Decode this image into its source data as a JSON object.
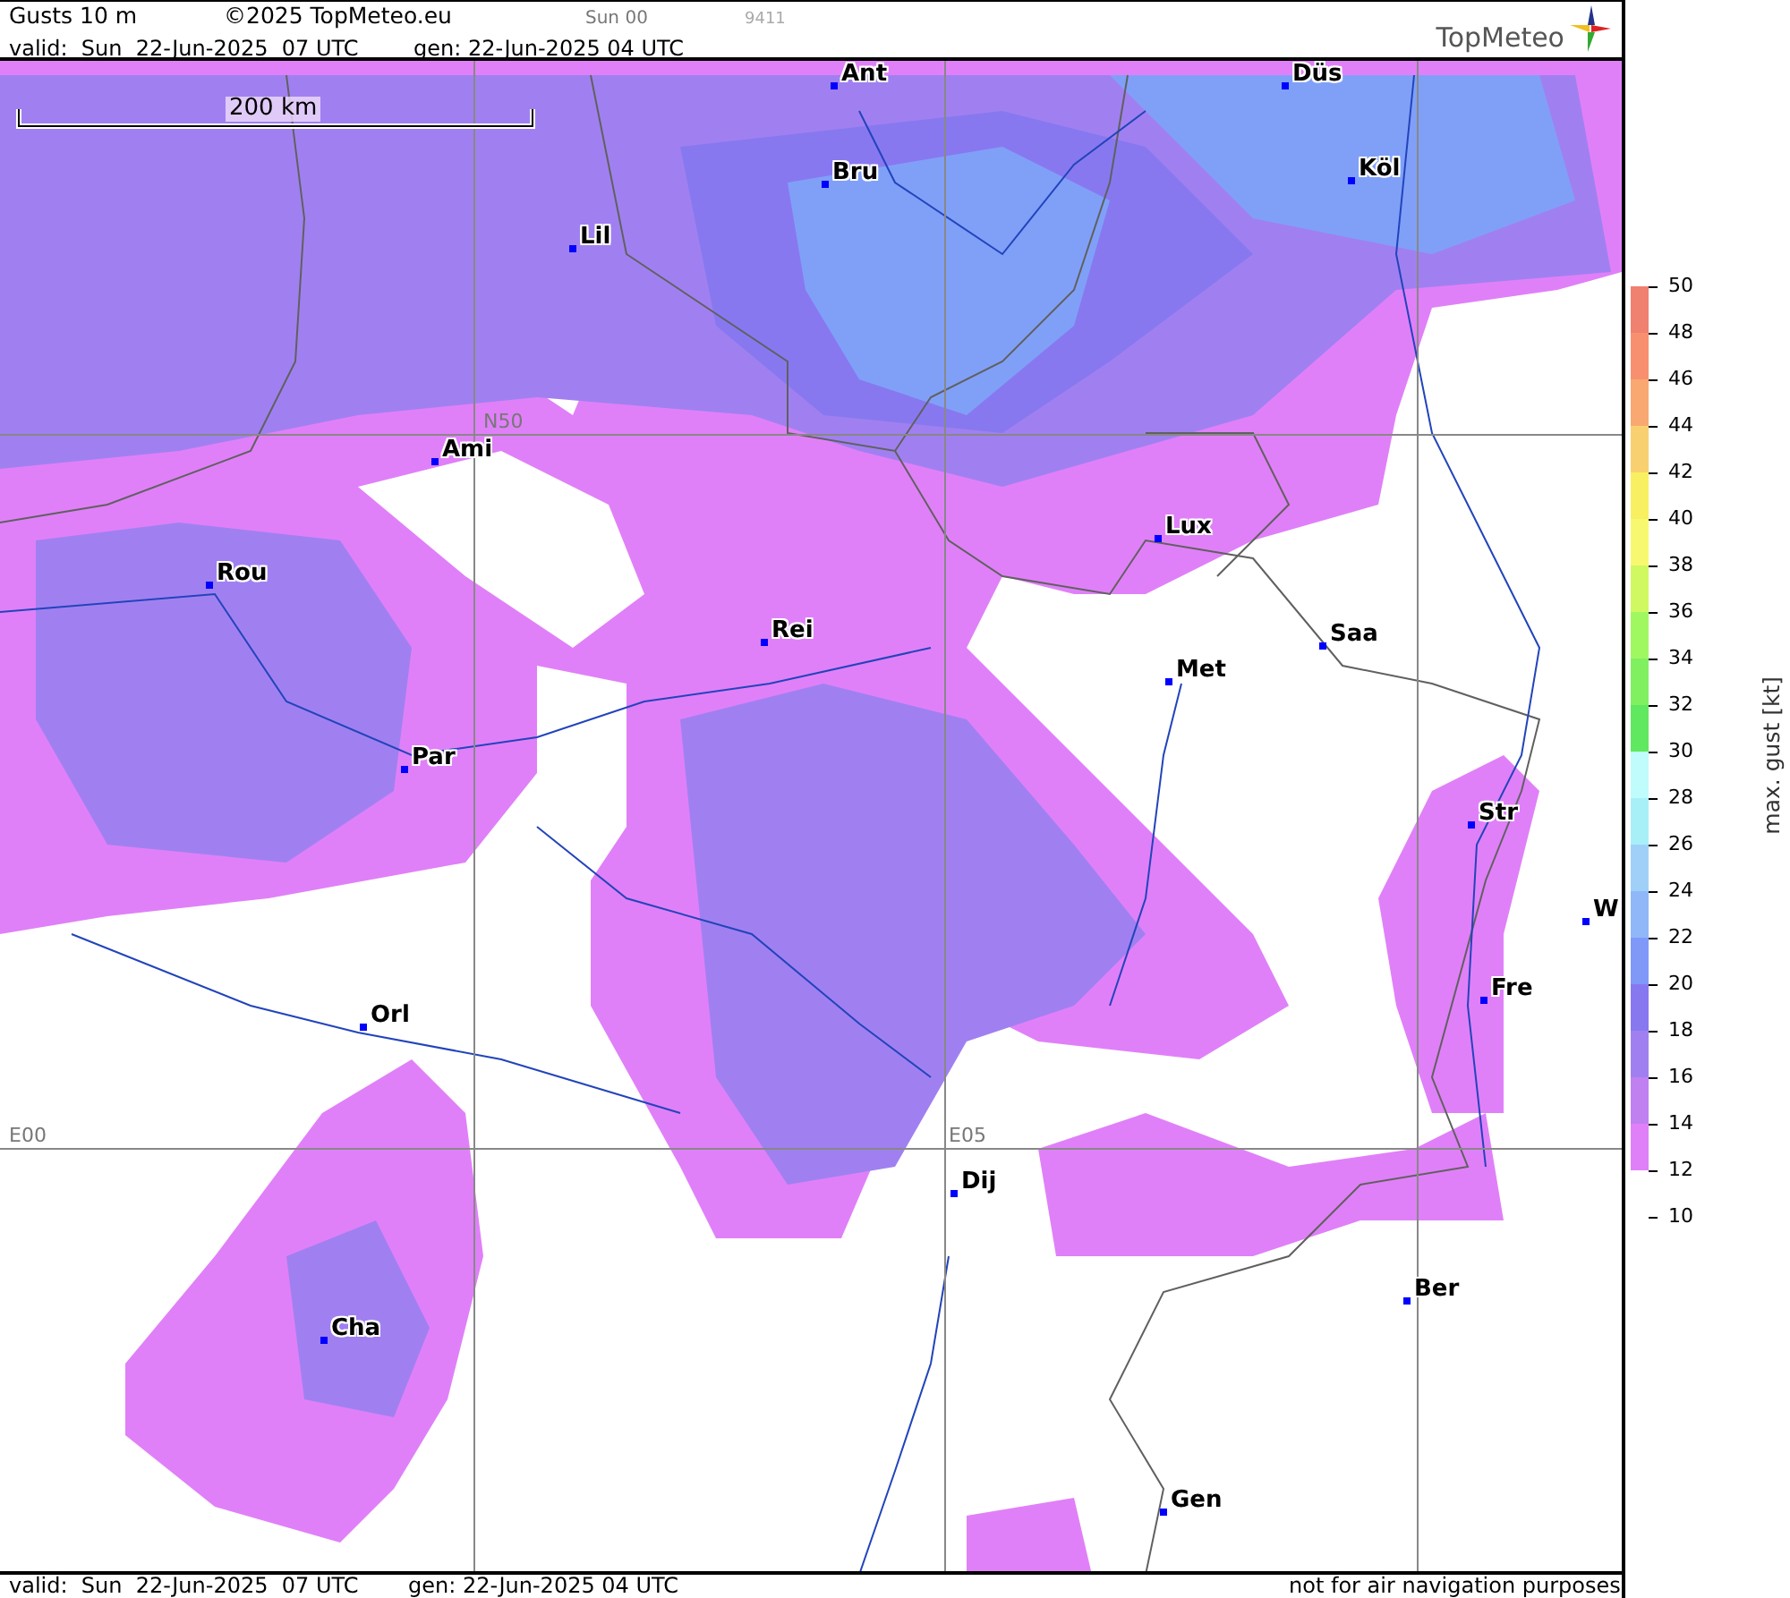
{
  "header": {
    "title": "Gusts 10 m",
    "copyright": "©2025 TopMeteo.eu",
    "run": "Sun 00",
    "code": "9411",
    "valid": "valid:  Sun  22-Jun-2025  07 UTC",
    "generated": "gen: 22-Jun-2025 04 UTC",
    "logo": "TopMeteo"
  },
  "map": {
    "scale": "200 km",
    "grid_labels": [
      {
        "text": "N50"
      },
      {
        "text": "E00"
      },
      {
        "text": "E05"
      }
    ],
    "cities": [
      {
        "name": "Ant"
      },
      {
        "name": "Düs"
      },
      {
        "name": "Bru"
      },
      {
        "name": "Köl"
      },
      {
        "name": "Lil"
      },
      {
        "name": "Ami"
      },
      {
        "name": "Rou"
      },
      {
        "name": "Lux"
      },
      {
        "name": "Saa"
      },
      {
        "name": "Rei"
      },
      {
        "name": "Met"
      },
      {
        "name": "Par"
      },
      {
        "name": "Str"
      },
      {
        "name": "W"
      },
      {
        "name": "Fre"
      },
      {
        "name": "Orl"
      },
      {
        "name": "Dij"
      },
      {
        "name": "Ber"
      },
      {
        "name": "Cha"
      },
      {
        "name": "Gen"
      }
    ]
  },
  "legend": {
    "title": "max. gust [kt]",
    "ticks": [
      "50",
      "48",
      "46",
      "44",
      "42",
      "40",
      "38",
      "36",
      "34",
      "32",
      "30",
      "28",
      "26",
      "24",
      "22",
      "20",
      "18",
      "16",
      "14",
      "12",
      "10"
    ],
    "bands": [
      {
        "color": "#f08070"
      },
      {
        "color": "#f89070"
      },
      {
        "color": "#f8a870"
      },
      {
        "color": "#f8d070"
      },
      {
        "color": "#f8f060"
      },
      {
        "color": "#f8f870"
      },
      {
        "color": "#d0f860"
      },
      {
        "color": "#a0f860"
      },
      {
        "color": "#80f060"
      },
      {
        "color": "#60e860"
      },
      {
        "color": "#c0fcfc"
      },
      {
        "color": "#a8f0f8"
      },
      {
        "color": "#a0d0f8"
      },
      {
        "color": "#90b8f8"
      },
      {
        "color": "#8098f8"
      },
      {
        "color": "#8878f0"
      },
      {
        "color": "#a080f0"
      },
      {
        "color": "#c080f0"
      },
      {
        "color": "#e080f8"
      }
    ]
  },
  "footer": {
    "valid": "valid:  Sun  22-Jun-2025  07 UTC",
    "generated": "gen: 22-Jun-2025 04 UTC",
    "note": "not for air navigation purposes"
  }
}
